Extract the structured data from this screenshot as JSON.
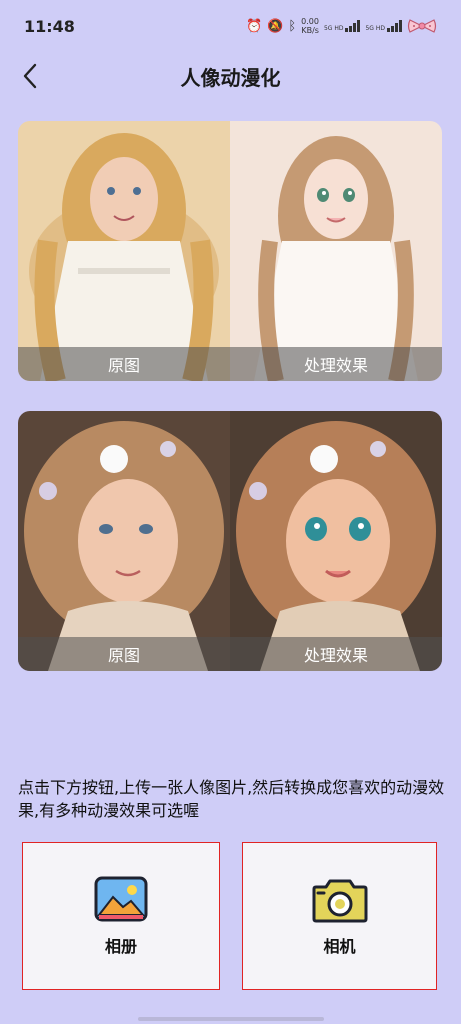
{
  "status_bar": {
    "time": "11:48",
    "net_speed_value": "0.00",
    "net_speed_unit": "KB/s",
    "sim1_label": "5G HD",
    "sim2_label": "5G HD",
    "icons": [
      "alarm-icon",
      "mute-icon",
      "bluetooth-icon",
      "signal-icon",
      "signal-icon",
      "bow-icon"
    ]
  },
  "header": {
    "title": "人像动漫化",
    "back_icon": "chevron-left-icon"
  },
  "examples": [
    {
      "original_label": "原图",
      "processed_label": "处理效果"
    },
    {
      "original_label": "原图",
      "processed_label": "处理效果"
    }
  ],
  "instruction": "点击下方按钮,上传一张人像图片,然后转换成您喜欢的动漫效果,有多种动漫效果可选喔",
  "actions": {
    "album": {
      "label": "相册",
      "icon": "gallery-icon"
    },
    "camera": {
      "label": "相机",
      "icon": "camera-icon"
    }
  },
  "colors": {
    "background": "#cfcdf7",
    "button_border": "#e02424",
    "button_bg": "#f5f4f8"
  }
}
